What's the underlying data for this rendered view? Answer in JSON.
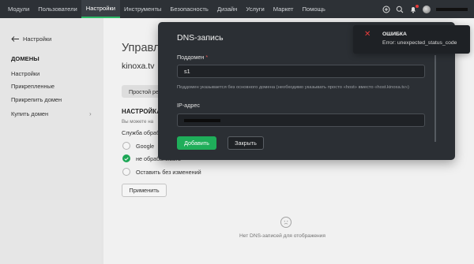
{
  "topnav": {
    "items": [
      "Модули",
      "Пользователи",
      "Настройки",
      "Инструменты",
      "Безопасность",
      "Дизайн",
      "Услуги",
      "Маркет",
      "Помощь"
    ],
    "active": "Настройки"
  },
  "top_icons": [
    "plus-circle-icon",
    "search-icon",
    "bell-icon",
    "avatar"
  ],
  "sidebar": {
    "back_label": "Настройки",
    "section_title": "ДОМЕНЫ",
    "links": [
      "Настройки",
      "Прикрепленные",
      "Прикрепить домен",
      "Купить домен"
    ]
  },
  "main": {
    "title": "Управл",
    "domain": "kinoxa.tv",
    "simple_btn": "Простой ре",
    "ns_title": "НАСТРОЙКА",
    "ns_desc": "Вы можете на",
    "service_label": "Служба обраб",
    "radios": [
      {
        "label": "Google",
        "checked": false
      },
      {
        "label": "не обрабатывать",
        "checked": true
      },
      {
        "label": "Оставить без изменений",
        "checked": false
      }
    ],
    "apply": "Применить",
    "empty": "Нет DNS-записей для отображения"
  },
  "modal": {
    "title": "DNS-запись",
    "subdomain_label": "Поддомен",
    "subdomain_required": "*",
    "subdomain_value": "s1",
    "subdomain_hint": "Поддомен указывается без основного домена (необходимо указывать просто «host» вместо «host.kinoxa.tv»)",
    "ip_label": "IP-адрес",
    "add": "Добавить",
    "close": "Закрыть"
  },
  "toast": {
    "title": "ОШИБКА",
    "message": "Error: unexpected_status_code"
  },
  "colors": {
    "accent": "#1fae5a",
    "topbar": "#2d3136",
    "modal": "#2b2f34",
    "error": "#e83b3b"
  }
}
